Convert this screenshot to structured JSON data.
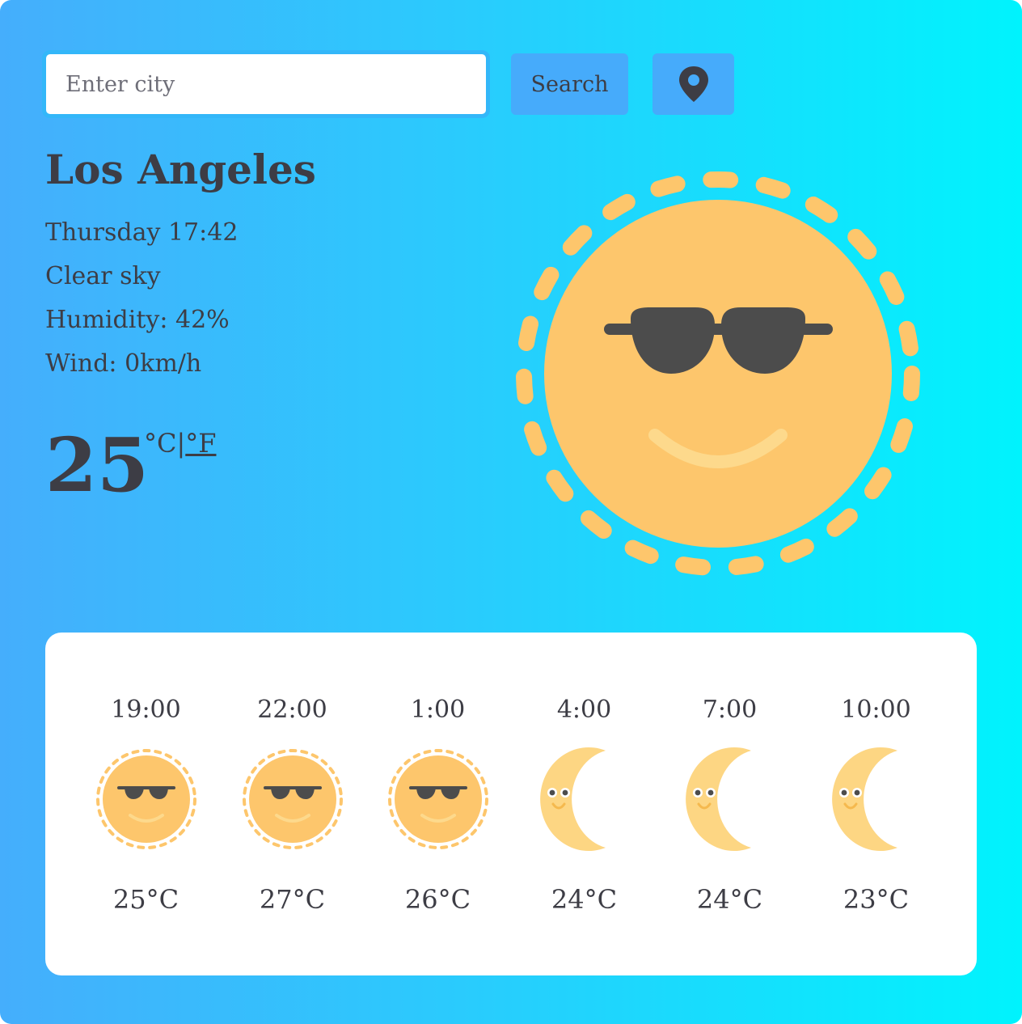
{
  "search": {
    "placeholder": "Enter city",
    "value": "",
    "button_label": "Search",
    "location_icon": "map-pin-icon"
  },
  "current": {
    "city": "Los Angeles",
    "datetime": "Thursday 17:42",
    "description": "Clear sky",
    "humidity_label": "Humidity:",
    "humidity_value": "42%",
    "wind_label": "Wind:",
    "wind_value": "0km/h",
    "temperature": "25",
    "unit_c": "°C",
    "unit_separator": "|",
    "unit_f": "°F",
    "icon": "sun-sunglasses-icon"
  },
  "forecast": [
    {
      "time": "19:00",
      "temp": "25°C",
      "icon": "sun"
    },
    {
      "time": "22:00",
      "temp": "27°C",
      "icon": "sun"
    },
    {
      "time": "1:00",
      "temp": "26°C",
      "icon": "sun"
    },
    {
      "time": "4:00",
      "temp": "24°C",
      "icon": "moon"
    },
    {
      "time": "7:00",
      "temp": "24°C",
      "icon": "moon"
    },
    {
      "time": "10:00",
      "temp": "23°C",
      "icon": "moon"
    }
  ],
  "colors": {
    "background_start": "#45aefc",
    "background_end": "#00f3fd",
    "sun": "#fdc66c",
    "sun_ray": "#fdc66c",
    "sunglasses": "#4c4c4c",
    "moon": "#fdd683",
    "text": "#3d3d45",
    "button": "#46abfb"
  }
}
